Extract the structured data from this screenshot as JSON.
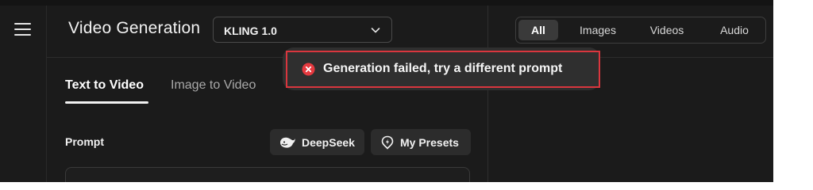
{
  "header": {
    "title": "Video Generation",
    "model_select": {
      "value": "KLING 1.0"
    }
  },
  "tabs": [
    {
      "label": "Text to Video",
      "active": true
    },
    {
      "label": "Image to Video",
      "active": false
    }
  ],
  "prompt": {
    "label": "Prompt",
    "actions": [
      {
        "label": "DeepSeek",
        "icon": "whale-icon"
      },
      {
        "label": "My Presets",
        "icon": "preset-icon"
      }
    ]
  },
  "filters": [
    {
      "label": "All",
      "active": true
    },
    {
      "label": "Images",
      "active": false
    },
    {
      "label": "Videos",
      "active": false
    },
    {
      "label": "Audio",
      "active": false
    }
  ],
  "toast": {
    "message": "Generation failed, try a different prompt",
    "icon": "error-icon",
    "accent": "#d9363e"
  },
  "colors": {
    "background": "#1b1b1b",
    "chip": "#2c2c2c",
    "error": "#e5393f"
  }
}
